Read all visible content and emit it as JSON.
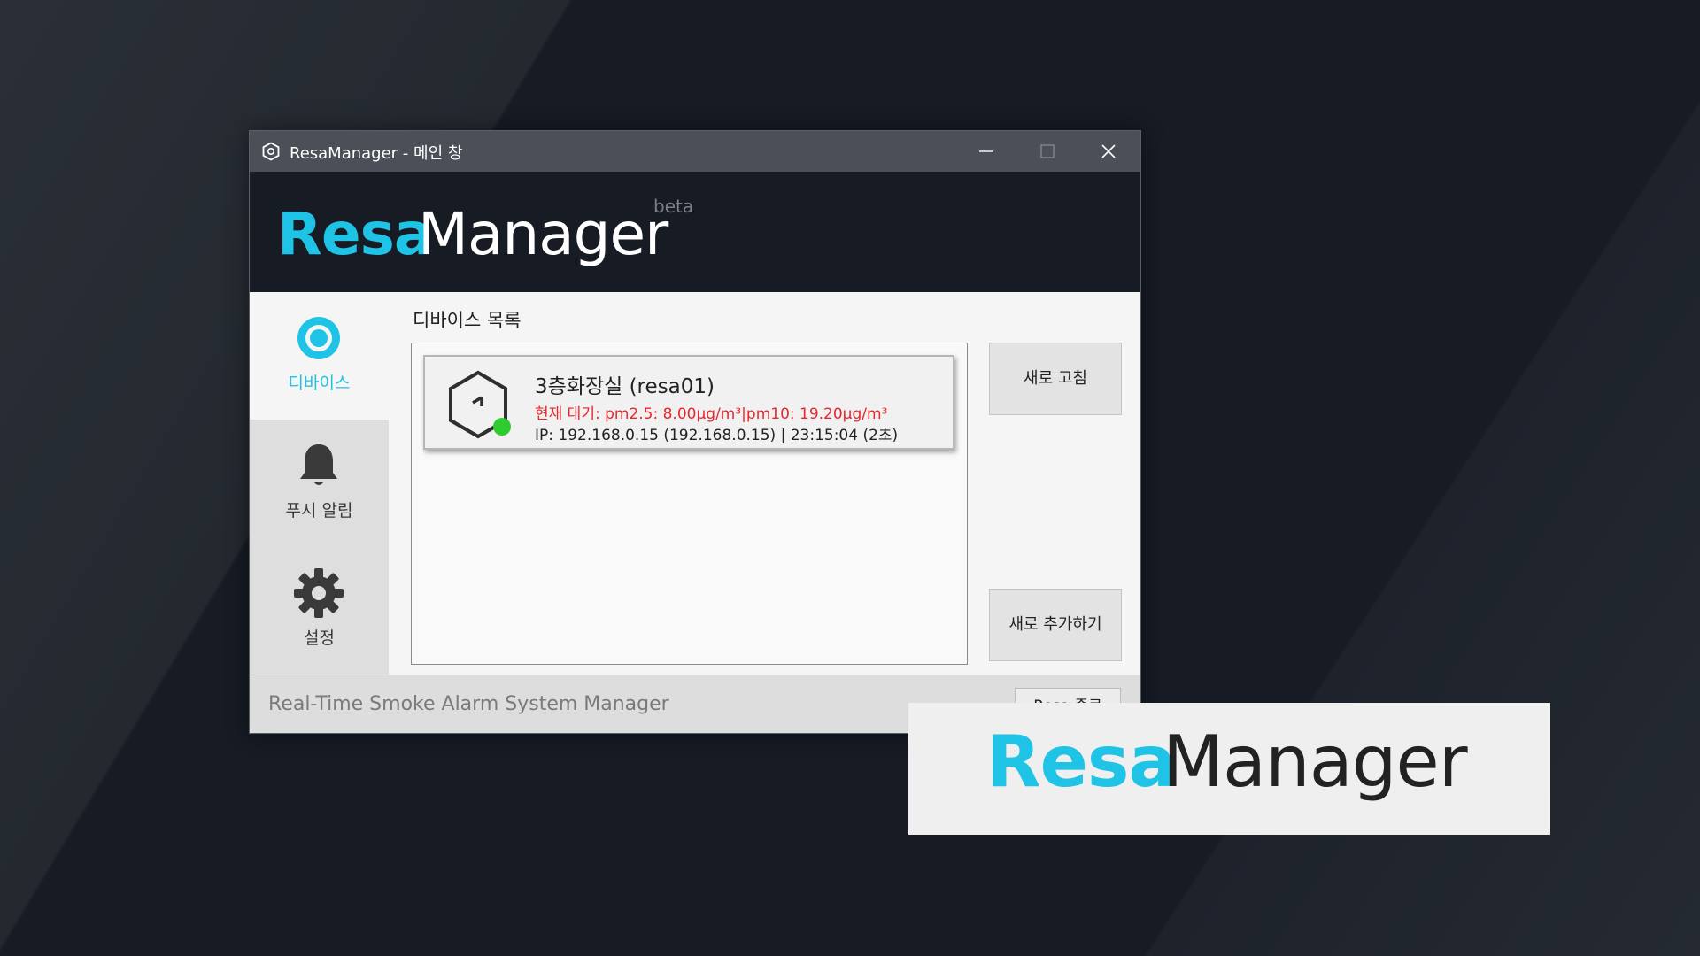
{
  "colors": {
    "accent": "#1ec3e6",
    "status_online": "#2ecc2e",
    "alert_text": "#e8262e",
    "titlebar": "#4a4f58",
    "header": "#171b23"
  },
  "window": {
    "title": "ResaManager - 메인 창",
    "controls": {
      "minimize_icon": "minimize-icon",
      "maximize_icon": "maximize-icon",
      "close_icon": "close-icon"
    }
  },
  "header": {
    "logo_part1": "Resa",
    "logo_part2": "Manager",
    "badge": "beta"
  },
  "sidebar": {
    "items": [
      {
        "label": "디바이스",
        "icon": "device-ring-icon",
        "active": true
      },
      {
        "label": "푸시 알림",
        "icon": "bell-icon",
        "active": false
      },
      {
        "label": "설정",
        "icon": "gear-icon",
        "active": false
      }
    ]
  },
  "main": {
    "section_title": "디바이스 목록",
    "devices": [
      {
        "name": "3층화장실 (resa01)",
        "air": "현재 대기: pm2.5: 8.00μg/m³|pm10: 19.20μg/m³",
        "ip": "IP: 192.168.0.15 (192.168.0.15) | 23:15:04 (2초)",
        "status": "online",
        "icon": "hexagon-sensor-icon"
      }
    ],
    "refresh_label": "새로 고침",
    "add_label": "새로 추가하기"
  },
  "footer": {
    "tagline": "Real-Time Smoke Alarm System Manager",
    "button_label": "Resa 종료"
  },
  "overlay": {
    "logo_part1": "Resa",
    "logo_part2": "Manager"
  }
}
